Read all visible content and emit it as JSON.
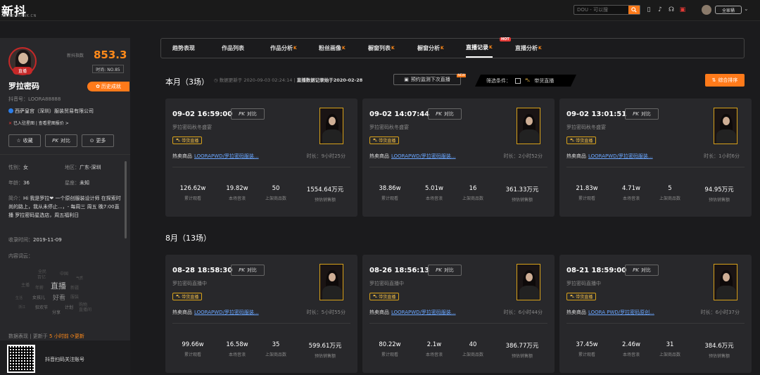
{
  "topbar": {
    "logo": "新抖",
    "logo_sub": "XD.NEWRANK.CN",
    "search_placeholder": "DOU - 可以搜",
    "plan_label": "全家桶"
  },
  "profile": {
    "avatar_badge": "直播",
    "index_label": "新抖指数",
    "index_value": "853.3",
    "rank": "时尚: NO.85",
    "name": "罗拉密码",
    "history_button": "历史成就",
    "douyin_id": "抖音号：LOORA88888",
    "company": "西萨皇宫（深圳）服装贸易有限公司",
    "star_text": "已入驻星图  |  查看星图报价 >",
    "buttons": {
      "collect": "收藏",
      "compare": "对比",
      "more": "更多"
    },
    "gender": {
      "label": "性别：",
      "value": "女"
    },
    "region": {
      "label": "地区：",
      "value": "广东-深圳"
    },
    "age": {
      "label": "年龄：",
      "value": "36"
    },
    "zodiac": {
      "label": "星座：",
      "value": "未知"
    },
    "intro_label": "简介：",
    "intro_text": "Hi 我是罗拉❤ 一个原创服装设计师 在探索时尚的路上，我从未停止...，- 每周三 周五 晚7:00直播 罗拉密码星选店，周五福利日",
    "join_label": "收录时间：",
    "join_value": "2019-11-09",
    "cloud_label": "内容词云：",
    "cloud_words": [
      "全民",
      "百亿",
      "中国",
      "气质",
      "直播",
      "主播",
      "年薪",
      "新疆",
      "女孩儿",
      "好看",
      "服装",
      "狂欢节",
      "计划",
      "购物",
      "直播间",
      "浙江",
      "分享",
      "生活",
      "文化",
      "老公",
      "老公",
      "购物"
    ],
    "perf_label": "数据表现  |  更新于",
    "perf_time": "5 小时前",
    "perf_refresh": "更新",
    "qr_text": "抖音扫码关注账号"
  },
  "tabs": [
    {
      "label": "趋势表现",
      "vip": false
    },
    {
      "label": "作品列表",
      "vip": false
    },
    {
      "label": "作品分析",
      "vip": true
    },
    {
      "label": "粉丝画像",
      "vip": true
    },
    {
      "label": "橱窗列表",
      "vip": true
    },
    {
      "label": "橱窗分析",
      "vip": true
    },
    {
      "label": "直播记录",
      "vip": true,
      "hot": "HOT",
      "active": true
    },
    {
      "label": "直播分析",
      "vip": true
    }
  ],
  "month1": {
    "title": "本月（3场）",
    "update_text": "数据更新于 2020-09-03 02:24:14  |",
    "update_bold": "直播数据记录始于2020-02-28",
    "reserve_button": "预约监测下次直播",
    "reserve_new": "NEW",
    "filter_label": "筛选条件：",
    "filter_option": "带货直播",
    "sort_button": "综合排序"
  },
  "month2": {
    "title": "8月（13场）"
  },
  "stat_labels": [
    "累计观看",
    "本场音浪",
    "上架商品数",
    "预估销售额"
  ],
  "common": {
    "pk": "对比",
    "tag": "带货直播",
    "hot_goods": "热卖商品"
  },
  "cards": [
    {
      "date": "09-02 16:59:00",
      "title": "罗拉密码秋冬盛宴",
      "product": "LOORAPWD/罗拉密码服装...",
      "duration": "时长：9小时25分",
      "stats": [
        "126.62w",
        "19.82w",
        "50",
        "1554.64万元"
      ]
    },
    {
      "date": "09-02 14:07:44",
      "title": "罗拉密码秋冬盛宴",
      "product": "LOORAPWD/罗拉密码服装...",
      "duration": "时长：2小时52分",
      "stats": [
        "38.86w",
        "5.01w",
        "16",
        "361.33万元"
      ]
    },
    {
      "date": "09-02 13:01:51",
      "title": "罗拉密码秋冬盛宴",
      "product": "LOORAPWD/罗拉密码服装...",
      "duration": "时长：1小时6分",
      "stats": [
        "21.83w",
        "4.71w",
        "5",
        "94.95万元"
      ]
    },
    {
      "date": "08-28 18:58:30",
      "title": "罗拉密码直播中",
      "product": "LOORAPWD/罗拉密码服装...",
      "duration": "时长：5小时55分",
      "stats": [
        "99.66w",
        "16.58w",
        "35",
        "599.61万元"
      ]
    },
    {
      "date": "08-26 18:56:13",
      "title": "罗拉密码直播中",
      "product": "LOORAPWD/罗拉密码服装...",
      "duration": "时长：6小时44分",
      "stats": [
        "80.22w",
        "2.1w",
        "40",
        "386.77万元"
      ]
    },
    {
      "date": "08-21 18:59:00",
      "title": "罗拉密码直播中",
      "product": "LOORA PWD/罗拉密码原创...",
      "duration": "时长：6小时37分",
      "stats": [
        "37.45w",
        "2.46w",
        "31",
        "384.6万元"
      ]
    }
  ],
  "colors": {
    "accent": "#ff7a1a",
    "link": "#6aa6ff",
    "gold": "#d9a21a"
  }
}
